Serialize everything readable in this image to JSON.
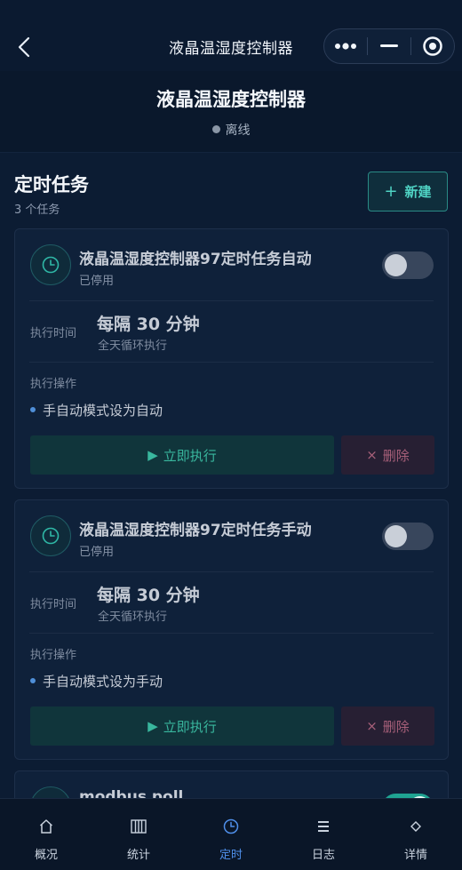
{
  "navbar": {
    "title": "液晶温湿度控制器",
    "back_icon": "chevron-left-icon",
    "capsule_icons": [
      "more-dots-icon",
      "minimize-icon",
      "target-icon"
    ]
  },
  "device": {
    "name": "液晶温湿度控制器",
    "status": "离线",
    "status_color": "#8a96a6"
  },
  "section": {
    "title": "定时任务",
    "count": "3 个任务",
    "new_label": "新建",
    "new_icon": "plus-icon"
  },
  "labels": {
    "exec_time": "执行时间",
    "exec_action": "执行操作",
    "run_now": "立即执行",
    "delete": "删除"
  },
  "tasks": [
    {
      "title": "液晶温湿度控制器97定时任务自动",
      "status": "已停用",
      "enabled": false,
      "interval": "每隔 30 分钟",
      "schedule": "全天循环执行",
      "action": "手自动模式设为自动"
    },
    {
      "title": "液晶温湿度控制器97定时任务手动",
      "status": "已停用",
      "enabled": false,
      "interval": "每隔 30 分钟",
      "schedule": "全天循环执行",
      "action": "手自动模式设为手动"
    },
    {
      "title": "modbus poll",
      "enabled": true
    }
  ],
  "tabs": [
    {
      "label": "概况",
      "icon": "home-icon",
      "active": false
    },
    {
      "label": "统计",
      "icon": "bars-icon",
      "active": false
    },
    {
      "label": "定时",
      "icon": "clock-icon",
      "active": true
    },
    {
      "label": "日志",
      "icon": "list-icon",
      "active": false
    },
    {
      "label": "详情",
      "icon": "diamond-icon",
      "active": false
    }
  ],
  "colors": {
    "accent_teal": "#4fd3c4",
    "active_tab": "#4f8fea",
    "background": "#0c1c33"
  }
}
